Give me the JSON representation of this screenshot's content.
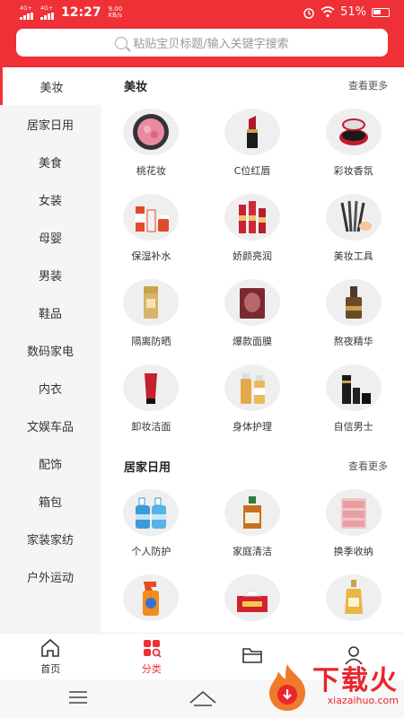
{
  "status": {
    "net1": "4G+",
    "net2": "4G+",
    "time": "12:27",
    "speed_value": "9.00",
    "speed_unit": "KB/s",
    "battery": "51%"
  },
  "search": {
    "placeholder": "粘贴宝贝标题/输入关键字搜索"
  },
  "sidebar": {
    "items": [
      {
        "label": "美妆"
      },
      {
        "label": "居家日用"
      },
      {
        "label": "美食"
      },
      {
        "label": "女装"
      },
      {
        "label": "母婴"
      },
      {
        "label": "男装"
      },
      {
        "label": "鞋品"
      },
      {
        "label": "数码家电"
      },
      {
        "label": "内衣"
      },
      {
        "label": "文娱车品"
      },
      {
        "label": "配饰"
      },
      {
        "label": "箱包"
      },
      {
        "label": "家装家纺"
      },
      {
        "label": "户外运动"
      }
    ],
    "active_index": 0
  },
  "sections": [
    {
      "title": "美妆",
      "more": "查看更多",
      "items": [
        {
          "label": "桃花妆",
          "icon": "blush-compact-icon"
        },
        {
          "label": "C位红唇",
          "icon": "lipstick-icon"
        },
        {
          "label": "彩妆香氛",
          "icon": "perfume-compact-icon"
        },
        {
          "label": "保湿补水",
          "icon": "moisturizer-bottles-icon"
        },
        {
          "label": "娇颜亮润",
          "icon": "skincare-set-icon"
        },
        {
          "label": "美妆工具",
          "icon": "makeup-brushes-icon"
        },
        {
          "label": "隔离防晒",
          "icon": "sunscreen-icon"
        },
        {
          "label": "爆款面膜",
          "icon": "face-mask-icon"
        },
        {
          "label": "熬夜精华",
          "icon": "serum-icon"
        },
        {
          "label": "卸妆洁面",
          "icon": "cleanser-tube-icon"
        },
        {
          "label": "身体护理",
          "icon": "body-care-icon"
        },
        {
          "label": "自信男士",
          "icon": "mens-care-icon"
        }
      ]
    },
    {
      "title": "居家日用",
      "more": "查看更多",
      "items": [
        {
          "label": "个人防护",
          "icon": "hand-soap-icon"
        },
        {
          "label": "家庭清洁",
          "icon": "disinfectant-icon"
        },
        {
          "label": "换季收纳",
          "icon": "storage-drawer-icon"
        },
        {
          "label": "",
          "icon": "spray-cleaner-icon"
        },
        {
          "label": "",
          "icon": "tissue-box-icon"
        },
        {
          "label": "",
          "icon": "shampoo-bottle-icon"
        }
      ]
    }
  ],
  "tabbar": {
    "items": [
      {
        "label": "首页",
        "icon": "home-icon"
      },
      {
        "label": "分类",
        "icon": "category-icon"
      },
      {
        "label": "",
        "icon": "folder-icon"
      },
      {
        "label": "",
        "icon": "user-icon"
      }
    ],
    "active_index": 1
  },
  "watermark": {
    "main": "下载火",
    "sub": "xiazaihuo.com"
  },
  "colors": {
    "accent": "#ef3036",
    "sidebar_bg": "#f5f5f5",
    "thumb_bg": "#efefef"
  }
}
